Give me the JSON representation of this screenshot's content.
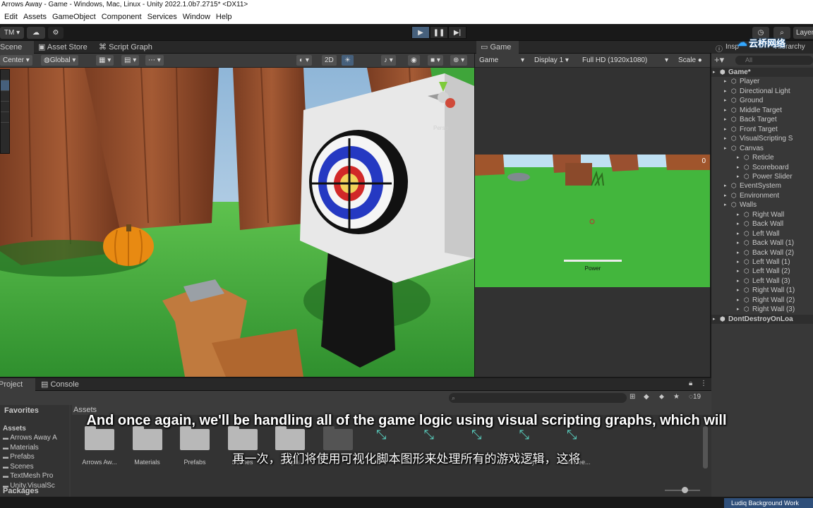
{
  "window": {
    "title": "Arrows Away - Game - Windows, Mac, Linux - Unity 2022.1.0b7.2715* <DX11>"
  },
  "menu": {
    "items": [
      "Edit",
      "Assets",
      "GameObject",
      "Component",
      "Services",
      "Window",
      "Help"
    ]
  },
  "toolbar": {
    "account_label": "TM",
    "layers_label": "Layer"
  },
  "tabs": {
    "scene": "Scene",
    "asset_store": "Asset Store",
    "script_graph": "Script Graph",
    "game": "Game",
    "inspector": "Insp",
    "hierarchy": "Hierarchy"
  },
  "scene_toolbar": {
    "pivot": "Center",
    "space": "Global",
    "mode_2d": "2D",
    "persp_label": "Persp"
  },
  "game_toolbar": {
    "view": "Game",
    "display": "Display 1",
    "resolution": "Full HD (1920x1080)",
    "scale": "Scale"
  },
  "game_hud": {
    "score": "0",
    "power_label": "Power"
  },
  "hierarchy": {
    "search_placeholder": "All",
    "items": [
      {
        "label": "Game*",
        "depth": 0
      },
      {
        "label": "Player",
        "depth": 1
      },
      {
        "label": "Directional Light",
        "depth": 1
      },
      {
        "label": "Ground",
        "depth": 1
      },
      {
        "label": "Middle Target",
        "depth": 1
      },
      {
        "label": "Back Target",
        "depth": 1
      },
      {
        "label": "Front Target",
        "depth": 1
      },
      {
        "label": "VisualScripting S",
        "depth": 1
      },
      {
        "label": "Canvas",
        "depth": 1
      },
      {
        "label": "Reticle",
        "depth": 2
      },
      {
        "label": "Scoreboard",
        "depth": 2
      },
      {
        "label": "Power Slider",
        "depth": 2
      },
      {
        "label": "EventSystem",
        "depth": 1
      },
      {
        "label": "Environment",
        "depth": 1
      },
      {
        "label": "Walls",
        "depth": 1
      },
      {
        "label": "Right Wall",
        "depth": 2
      },
      {
        "label": "Back Wall",
        "depth": 2
      },
      {
        "label": "Left Wall",
        "depth": 2
      },
      {
        "label": "Back Wall (1)",
        "depth": 2
      },
      {
        "label": "Back Wall (2)",
        "depth": 2
      },
      {
        "label": "Left Wall (1)",
        "depth": 2
      },
      {
        "label": "Left Wall (2)",
        "depth": 2
      },
      {
        "label": "Left Wall (3)",
        "depth": 2
      },
      {
        "label": "Right Wall (1)",
        "depth": 2
      },
      {
        "label": "Right Wall (2)",
        "depth": 2
      },
      {
        "label": "Right Wall (3)",
        "depth": 2
      },
      {
        "label": "DontDestroyOnLoa",
        "depth": 0
      }
    ]
  },
  "bottom": {
    "tabs": {
      "project": "Project",
      "console": "Console"
    },
    "favorites": "Favorites",
    "assets_root": "Assets",
    "tree": [
      "Arrows Away A",
      "Materials",
      "Prefabs",
      "Scenes",
      "TextMesh Pro",
      "Unity.VisualSc"
    ],
    "packages": "Packages",
    "breadcrumb": "Assets",
    "count_badge": "19",
    "asset_labels": [
      "Arrows Aw...",
      "Materials",
      "Prefabs",
      "Scenes",
      "Scripts",
      "",
      "",
      "",
      "",
      "reDy",
      "coreKee..."
    ]
  },
  "subtitle": {
    "english": "And once again, we'll be handling all of the game logic using visual scripting graphs, which will",
    "chinese": "再一次，我们将使用可视化脚本图形来处理所有的游戏逻辑，这将"
  },
  "watermark": {
    "text": "云桥网络"
  },
  "status": {
    "right": "Ludiq Background Work"
  },
  "colors": {
    "accent": "#46607c",
    "panel": "#383838",
    "grass": "#3fa53a",
    "wood": "#8b4a2b"
  }
}
